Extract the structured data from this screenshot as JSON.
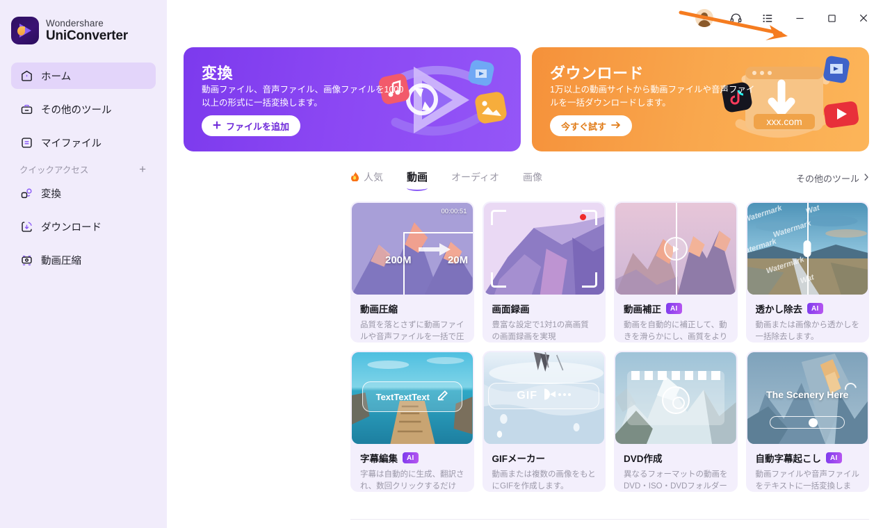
{
  "app": {
    "brand_line1": "Wondershare",
    "brand_line2": "UniConverter"
  },
  "titlebar": {
    "account_icon": "avatar-icon",
    "support_icon": "headset-icon",
    "menu_icon": "list-menu-icon",
    "minimize_icon": "minimize-icon",
    "maximize_icon": "maximize-icon",
    "close_icon": "close-icon"
  },
  "sidebar": {
    "items": [
      {
        "label": "ホーム",
        "icon": "home-icon",
        "active": true
      },
      {
        "label": "その他のツール",
        "icon": "toolbox-icon",
        "active": false
      },
      {
        "label": "マイファイル",
        "icon": "file-list-icon",
        "active": false
      }
    ],
    "quick_access": {
      "title": "クイックアクセス",
      "add_label": "+",
      "items": [
        {
          "label": "変換",
          "icon": "convert-icon"
        },
        {
          "label": "ダウンロード",
          "icon": "download-icon"
        },
        {
          "label": "動画圧縮",
          "icon": "compress-icon"
        }
      ]
    }
  },
  "banners": [
    {
      "id": "convert",
      "title": "変換",
      "desc": "動画ファイル、音声ファイル、画像ファイルを1000以上の形式に一括変換します。",
      "button": "ファイルを追加",
      "button_icon": "plus-icon",
      "color": "#7c3aed"
    },
    {
      "id": "download",
      "title": "ダウンロード",
      "desc": "1万以上の動画サイトから動画ファイルや音声ファイルを一括ダウンロードします。",
      "button": "今すぐ試す",
      "button_icon": "arrow-right-icon",
      "color": "#f5913a",
      "art_label": "xxx.com"
    }
  ],
  "tabs": {
    "items": [
      {
        "label": "人気",
        "icon": "fire-icon",
        "active": false
      },
      {
        "label": "動画",
        "icon": "",
        "active": true
      },
      {
        "label": "オーディオ",
        "icon": "",
        "active": false
      },
      {
        "label": "画像",
        "icon": "",
        "active": false
      }
    ],
    "more_tools": "その他のツール",
    "more_tools_icon": "chevron-right-icon"
  },
  "cards": [
    {
      "title": "動画圧縮",
      "ai": false,
      "desc": "品質を落とさずに動画ファイルや音声ファイルを一括で圧縮します。",
      "thumb": {
        "kind": "compress",
        "time_badge": "00:00:51",
        "from_label": "200M",
        "to_label": "20M"
      }
    },
    {
      "title": "画面録画",
      "ai": false,
      "desc": "豊富な設定で1対1の高画質の画面録画を実現",
      "thumb": {
        "kind": "record"
      }
    },
    {
      "title": "動画補正",
      "ai": true,
      "ai_label": "AI",
      "desc": "動画を自動的に補正して、動きを滑らかにし、画質をより鮮明にします。",
      "thumb": {
        "kind": "enhance"
      }
    },
    {
      "title": "透かし除去",
      "ai": true,
      "ai_label": "AI",
      "desc": "動画または画像から透かしを一括除去します。",
      "thumb": {
        "kind": "watermark",
        "watermark_text": "Watermark"
      }
    },
    {
      "title": "字幕編集",
      "ai": true,
      "ai_label": "AI",
      "desc": "字幕は自動的に生成、翻訳され、数回クリックするだけで編集と同期ができま...",
      "thumb": {
        "kind": "subtitle",
        "pill_text": "TextTextText",
        "pill_icon": "pencil-icon"
      }
    },
    {
      "title": "GIFメーカー",
      "ai": false,
      "desc": "動画または複数の画像をもとにGIFを作成します。",
      "thumb": {
        "kind": "gif",
        "pill_text": "GIF",
        "pill_icon": "pacman-icon"
      }
    },
    {
      "title": "DVD作成",
      "ai": false,
      "desc": "異なるフォーマットの動画をDVD・ISO・DVDフォルダーに書き込む",
      "thumb": {
        "kind": "dvd"
      }
    },
    {
      "title": "自動字幕起こし",
      "ai": true,
      "ai_label": "AI",
      "desc": "動画ファイルや音声ファイルをテキストに一括変換します。",
      "thumb": {
        "kind": "transcribe",
        "caption": "The Scenery Here"
      }
    }
  ],
  "annotation": {
    "shape": "orange-arrow",
    "color": "#f57c20"
  }
}
